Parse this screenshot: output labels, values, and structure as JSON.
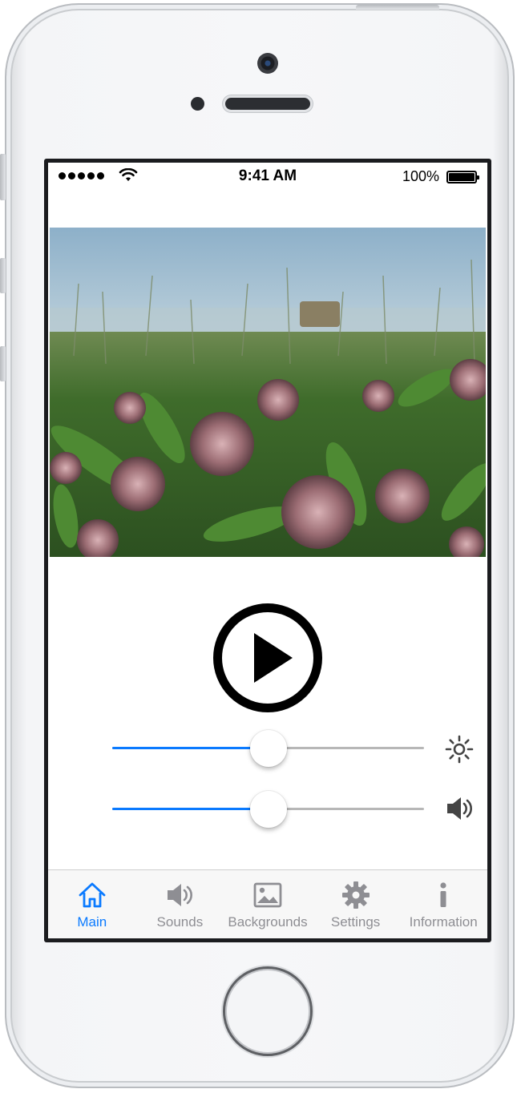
{
  "status_bar": {
    "time": "9:41 AM",
    "battery_percent": "100%"
  },
  "hero_image": {
    "subject": "milkweed-flowers-by-lake"
  },
  "player": {
    "play_icon": "play-circle-icon"
  },
  "sliders": {
    "brightness": {
      "icon": "sun-icon",
      "level": 0.5
    },
    "volume": {
      "icon": "speaker-icon",
      "level": 0.5
    }
  },
  "tab_bar": {
    "active": "main",
    "tabs": [
      {
        "id": "main",
        "label": "Main",
        "icon": "home-icon"
      },
      {
        "id": "sounds",
        "label": "Sounds",
        "icon": "speaker-icon"
      },
      {
        "id": "backgrounds",
        "label": "Backgrounds",
        "icon": "image-icon"
      },
      {
        "id": "settings",
        "label": "Settings",
        "icon": "gear-icon"
      },
      {
        "id": "information",
        "label": "Information",
        "icon": "info-icon"
      }
    ]
  },
  "colors": {
    "accent": "#0a7aff",
    "inactive_tab": "#8e8e93",
    "track": "#b7b7b7"
  }
}
